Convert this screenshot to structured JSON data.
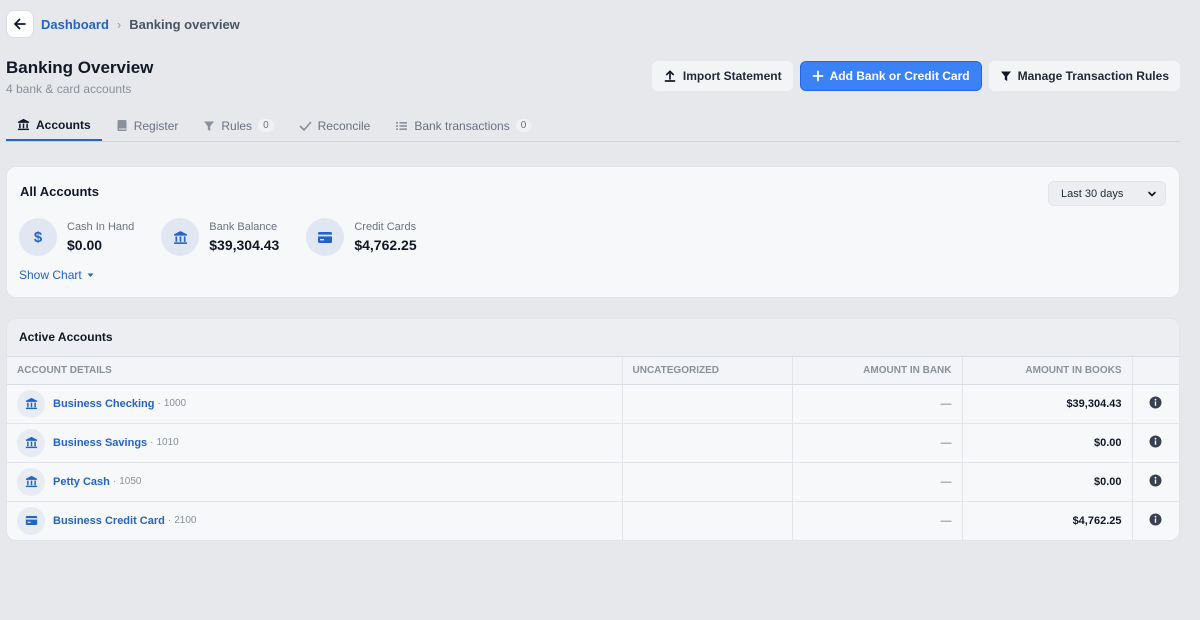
{
  "breadcrumb": {
    "parent": "Dashboard",
    "separator": "›",
    "current": "Banking overview"
  },
  "header": {
    "title": "Banking Overview",
    "subtitle": "4 bank & card accounts"
  },
  "actions": {
    "import": "Import Statement",
    "add": "Add Bank or Credit Card",
    "rules": "Manage Transaction Rules"
  },
  "tabs": [
    {
      "label": "Accounts",
      "active": true
    },
    {
      "label": "Register"
    },
    {
      "label": "Rules",
      "badge": "0"
    },
    {
      "label": "Reconcile"
    },
    {
      "label": "Bank transactions",
      "badge": "0"
    }
  ],
  "all_accounts": {
    "title": "All Accounts",
    "period": "Last 30 days",
    "summary": [
      {
        "label": "Cash In Hand",
        "value": "$0.00",
        "icon": "dollar-icon"
      },
      {
        "label": "Bank Balance",
        "value": "$39,304.43",
        "icon": "bank-icon"
      },
      {
        "label": "Credit Cards",
        "value": "$4,762.25",
        "icon": "credit-card-icon"
      }
    ],
    "show_chart": "Show Chart"
  },
  "active_accounts": {
    "title": "Active Accounts",
    "columns": [
      "Account Details",
      "Uncategorized",
      "Amount in Bank",
      "Amount in Books"
    ],
    "rows": [
      {
        "name": "Business Checking",
        "sep": "·",
        "number": "1000",
        "uncategorized": "",
        "bank": "—",
        "books": "$39,304.43",
        "icon": "bank-icon"
      },
      {
        "name": "Business Savings",
        "sep": "·",
        "number": "1010",
        "uncategorized": "",
        "bank": "—",
        "books": "$0.00",
        "icon": "bank-icon"
      },
      {
        "name": "Petty Cash",
        "sep": "·",
        "number": "1050",
        "uncategorized": "",
        "bank": "—",
        "books": "$0.00",
        "icon": "bank-icon"
      },
      {
        "name": "Business Credit Card",
        "sep": "·",
        "number": "2100",
        "uncategorized": "",
        "bank": "—",
        "books": "$4,762.25",
        "icon": "credit-card-icon"
      }
    ]
  },
  "colors": {
    "accent": "#2563c7",
    "primary_button": "#3b82f6",
    "background": "#e6e8ec"
  }
}
